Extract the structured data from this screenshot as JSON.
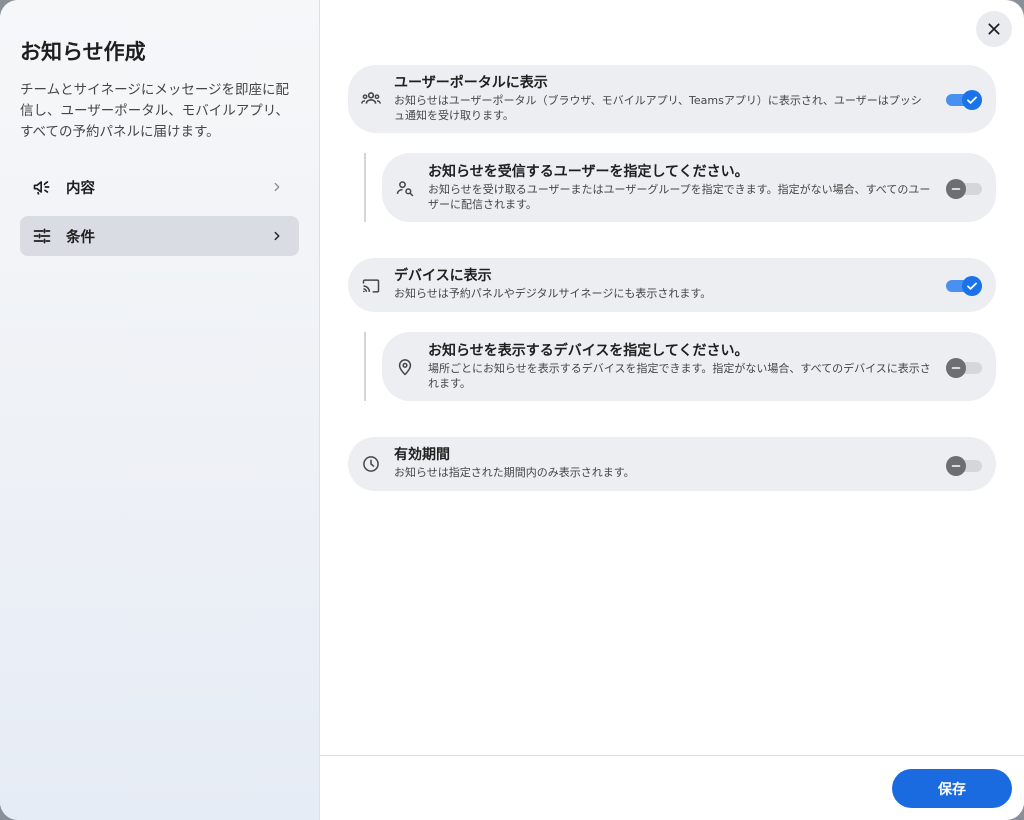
{
  "sidebar": {
    "title": "お知らせ作成",
    "description": "チームとサイネージにメッセージを即座に配信し、ユーザーポータル、モバイルアプリ、すべての予約パネルに届けます。",
    "items": [
      {
        "label": "内容",
        "icon": "megaphone-icon",
        "active": false
      },
      {
        "label": "条件",
        "icon": "tune-icon",
        "active": true
      }
    ]
  },
  "main": {
    "close_icon": "close-icon",
    "cards": [
      {
        "title": "ユーザーポータルに表示",
        "description": "お知らせはユーザーポータル（ブラウザ、モバイルアプリ、Teamsアプリ）に表示され、ユーザーはプッシュ通知を受け取ります。",
        "icon": "groups-icon",
        "toggle": "on"
      },
      {
        "title": "お知らせを受信するユーザーを指定してください。",
        "description": "お知らせを受け取るユーザーまたはユーザーグループを指定できます。指定がない場合、すべてのユーザーに配信されます。",
        "icon": "person-search-icon",
        "toggle": "off"
      },
      {
        "title": "デバイスに表示",
        "description": "お知らせは予約パネルやデジタルサイネージにも表示されます。",
        "icon": "cast-icon",
        "toggle": "on"
      },
      {
        "title": "お知らせを表示するデバイスを指定してください。",
        "description": "場所ごとにお知らせを表示するデバイスを指定できます。指定がない場合、すべてのデバイスに表示されます。",
        "icon": "location-pin-icon",
        "toggle": "off"
      },
      {
        "title": "有効期間",
        "description": "お知らせは指定された期間内のみ表示されます。",
        "icon": "clock-icon",
        "toggle": "off"
      }
    ]
  },
  "footer": {
    "save_label": "保存"
  },
  "colors": {
    "accent": "#1a73e8",
    "card_bg": "#eceef1",
    "save_button": "#1a6be0"
  }
}
